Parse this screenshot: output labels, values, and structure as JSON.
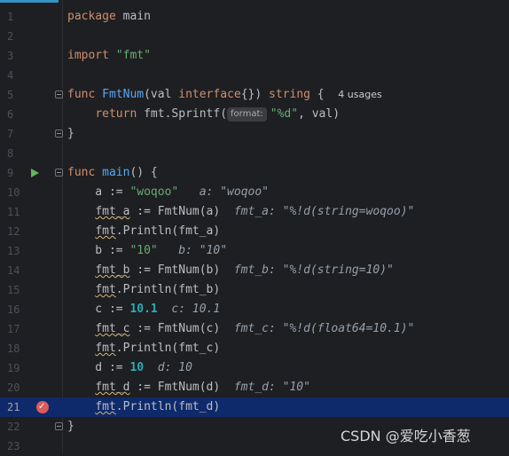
{
  "editor": {
    "current_line": 21,
    "breakpoint_line": 21,
    "run_line": 9
  },
  "lines": [
    {
      "n": "1",
      "tokens": [
        [
          "kw",
          "package"
        ],
        [
          "pkg",
          " main"
        ]
      ]
    },
    {
      "n": "2",
      "tokens": []
    },
    {
      "n": "3",
      "tokens": [
        [
          "kw",
          "import"
        ],
        [
          "pkg",
          " "
        ],
        [
          "str",
          "\"fmt\""
        ]
      ]
    },
    {
      "n": "4",
      "tokens": []
    },
    {
      "n": "5",
      "tokens": [
        [
          "kw",
          "func"
        ],
        [
          "pkg",
          " "
        ],
        [
          "fn",
          "FmtNum"
        ],
        [
          "pkg",
          "(val "
        ],
        [
          "kw",
          "interface"
        ],
        [
          "pkg",
          "{}) "
        ],
        [
          "kw",
          "string"
        ],
        [
          "pkg",
          " {  "
        ],
        [
          "usages",
          "4 usages"
        ]
      ]
    },
    {
      "n": "6",
      "tokens": [
        [
          "pkg",
          "    "
        ],
        [
          "kw",
          "return"
        ],
        [
          "pkg",
          " fmt.Sprintf("
        ],
        [
          "badge",
          "format:"
        ],
        [
          "str",
          "\"%d\""
        ],
        [
          "pkg",
          ", val)"
        ]
      ]
    },
    {
      "n": "7",
      "tokens": [
        [
          "pkg",
          "}"
        ]
      ]
    },
    {
      "n": "8",
      "tokens": []
    },
    {
      "n": "9",
      "tokens": [
        [
          "kw",
          "func"
        ],
        [
          "pkg",
          " "
        ],
        [
          "fn",
          "main"
        ],
        [
          "pkg",
          "() {"
        ]
      ]
    },
    {
      "n": "10",
      "tokens": [
        [
          "pkg",
          "    a := "
        ],
        [
          "str",
          "\"woqoo\""
        ],
        [
          "pkg",
          "   "
        ],
        [
          "hint",
          "a: \"woqoo\""
        ]
      ]
    },
    {
      "n": "11",
      "tokens": [
        [
          "pkgsq",
          "    fmt_a"
        ],
        [
          "pkg",
          " := FmtNum(a)  "
        ],
        [
          "hint",
          "fmt_a: \"%!d(string=woqoo)\""
        ]
      ]
    },
    {
      "n": "12",
      "tokens": [
        [
          "pkgsq",
          "    fmt"
        ],
        [
          "pkg",
          ".Println(fmt_a)"
        ]
      ]
    },
    {
      "n": "13",
      "tokens": [
        [
          "pkg",
          "    b := "
        ],
        [
          "str",
          "\"10\""
        ],
        [
          "pkg",
          "   "
        ],
        [
          "hint",
          "b: \"10\""
        ]
      ]
    },
    {
      "n": "14",
      "tokens": [
        [
          "pkgsq",
          "    fmt_b"
        ],
        [
          "pkg",
          " := FmtNum(b)  "
        ],
        [
          "hint",
          "fmt_b: \"%!d(string=10)\""
        ]
      ]
    },
    {
      "n": "15",
      "tokens": [
        [
          "pkgsq",
          "    fmt"
        ],
        [
          "pkg",
          ".Println(fmt_b)"
        ]
      ]
    },
    {
      "n": "16",
      "tokens": [
        [
          "pkg",
          "    c := "
        ],
        [
          "num",
          "10.1"
        ],
        [
          "pkg",
          "  "
        ],
        [
          "hint",
          "c: 10.1"
        ]
      ]
    },
    {
      "n": "17",
      "tokens": [
        [
          "pkgsq",
          "    fmt_c"
        ],
        [
          "pkg",
          " := FmtNum(c)  "
        ],
        [
          "hint",
          "fmt_c: \"%!d(float64=10.1)\""
        ]
      ]
    },
    {
      "n": "18",
      "tokens": [
        [
          "pkgsq",
          "    fmt"
        ],
        [
          "pkg",
          ".Println(fmt_c)"
        ]
      ]
    },
    {
      "n": "19",
      "tokens": [
        [
          "pkg",
          "    d := "
        ],
        [
          "num",
          "10"
        ],
        [
          "pkg",
          "  "
        ],
        [
          "hint",
          "d: 10"
        ]
      ]
    },
    {
      "n": "20",
      "tokens": [
        [
          "pkgsq",
          "    fmt_d"
        ],
        [
          "pkg",
          " := FmtNum(d)  "
        ],
        [
          "hint",
          "fmt_d: \"10\""
        ]
      ]
    },
    {
      "n": "21",
      "tokens": [
        [
          "pkgsq",
          "    fmt"
        ],
        [
          "pkg",
          ".Println(fmt_d)"
        ]
      ]
    },
    {
      "n": "22",
      "tokens": [
        [
          "pkg",
          "}"
        ]
      ]
    },
    {
      "n": "23",
      "tokens": []
    }
  ],
  "watermark": "CSDN @爱吃小香葱",
  "colors": {
    "keyword": "#cf8e6d",
    "function": "#56a8f5",
    "string": "#6aab73",
    "number": "#2aacb8",
    "highlight": "#0f2a6b",
    "breakpoint": "#db5c5c",
    "run": "#5fb65f"
  }
}
